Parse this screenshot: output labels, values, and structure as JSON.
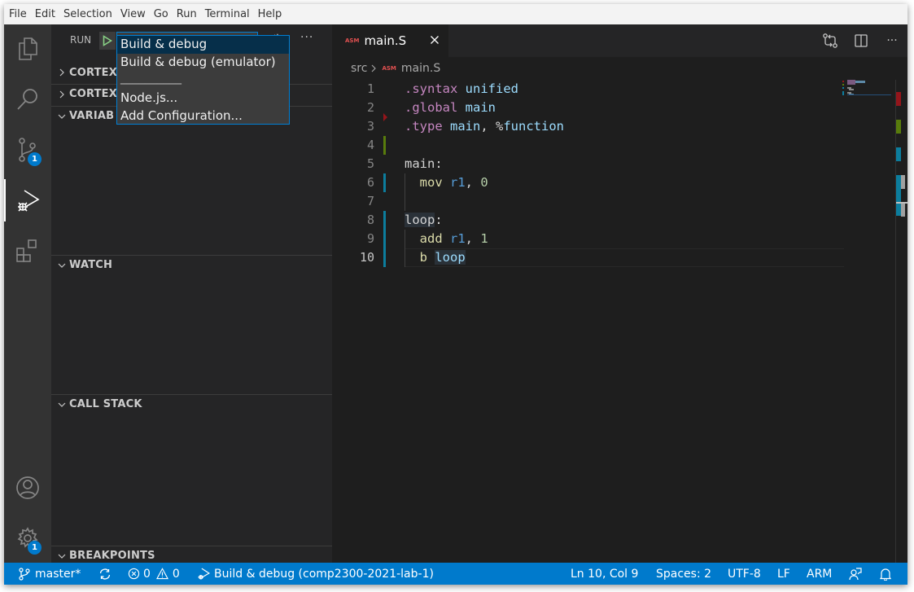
{
  "menu": [
    "File",
    "Edit",
    "Selection",
    "View",
    "Go",
    "Run",
    "Terminal",
    "Help"
  ],
  "activity_bar": {
    "items": [
      {
        "name": "explorer",
        "icon": "files-icon"
      },
      {
        "name": "search",
        "icon": "search-icon"
      },
      {
        "name": "source-control",
        "icon": "source-control-icon",
        "badge": "1"
      },
      {
        "name": "run-and-debug",
        "icon": "debug-icon",
        "active": true
      },
      {
        "name": "extensions",
        "icon": "extensions-icon"
      }
    ],
    "bottom": [
      {
        "name": "accounts",
        "icon": "account-icon"
      },
      {
        "name": "manage",
        "icon": "gear-icon",
        "badge": "1"
      }
    ]
  },
  "sidebar": {
    "run_label": "RUN",
    "config_selected": "Build & debug",
    "sections": [
      {
        "title": "CORTEX",
        "expanded": false
      },
      {
        "title": "CORTEX",
        "expanded": false
      },
      {
        "title": "VARIABLES",
        "visible_text": "VARIAB",
        "expanded": true
      },
      {
        "title": "WATCH",
        "expanded": true
      },
      {
        "title": "CALL STACK",
        "expanded": true
      },
      {
        "title": "BREAKPOINTS",
        "expanded": true
      }
    ]
  },
  "dropdown": {
    "items": [
      "Build & debug",
      "Build & debug (emulator)",
      "__________",
      "Node.js...",
      "Add Configuration..."
    ],
    "selected_index": 0
  },
  "editor": {
    "tab": {
      "badge": "ASM",
      "name": "main.S"
    },
    "breadcrumb": {
      "folder": "src",
      "badge": "ASM",
      "file": "main.S"
    },
    "lines": [
      {
        "n": "1",
        "tokens": [
          {
            "t": ".syntax ",
            "c": "dir"
          },
          {
            "t": "unified",
            "c": "id"
          }
        ]
      },
      {
        "n": "2",
        "tokens": [
          {
            "t": ".global ",
            "c": "dir"
          },
          {
            "t": "main",
            "c": "id"
          }
        ]
      },
      {
        "n": "3",
        "tokens": [
          {
            "t": ".type ",
            "c": "dir"
          },
          {
            "t": "main",
            "c": "id"
          },
          {
            "t": ", %",
            "c": "plain"
          },
          {
            "t": "function",
            "c": "id"
          }
        ]
      },
      {
        "n": "4",
        "tokens": []
      },
      {
        "n": "5",
        "tokens": [
          {
            "t": "main:",
            "c": "plain"
          }
        ]
      },
      {
        "n": "6",
        "tokens": [
          {
            "t": "  mov ",
            "c": "op"
          },
          {
            "t": "r1",
            "c": "reg"
          },
          {
            "t": ", ",
            "c": "plain"
          },
          {
            "t": "0",
            "c": "num"
          }
        ]
      },
      {
        "n": "7",
        "tokens": []
      },
      {
        "n": "8",
        "tokens": [
          {
            "t": "loop",
            "c": "plain",
            "hl": true
          },
          {
            "t": ":",
            "c": "plain"
          }
        ]
      },
      {
        "n": "9",
        "tokens": [
          {
            "t": "  add ",
            "c": "op"
          },
          {
            "t": "r1",
            "c": "reg"
          },
          {
            "t": ", ",
            "c": "plain"
          },
          {
            "t": "1",
            "c": "num"
          }
        ]
      },
      {
        "n": "10",
        "tokens": [
          {
            "t": "  b ",
            "c": "op"
          },
          {
            "t": "loop",
            "c": "id",
            "hl": true
          }
        ]
      }
    ],
    "current_line": "10"
  },
  "statusbar": {
    "branch": "master*",
    "errors": "0",
    "warnings": "0",
    "debug_config": "Build & debug (comp2300-2021-lab-1)",
    "position": "Ln 10, Col 9",
    "spaces": "Spaces: 2",
    "encoding": "UTF-8",
    "eol": "LF",
    "language": "ARM"
  },
  "colors": {
    "accent": "#007acc",
    "directive": "#c586c0",
    "identifier": "#9cdcfe",
    "opcode": "#dcdcaa",
    "register": "#569cd6",
    "number": "#b5cea8",
    "gutter_added": "#587c0c",
    "gutter_modified": "#0c7d9d",
    "gutter_deleted": "#94151b"
  }
}
